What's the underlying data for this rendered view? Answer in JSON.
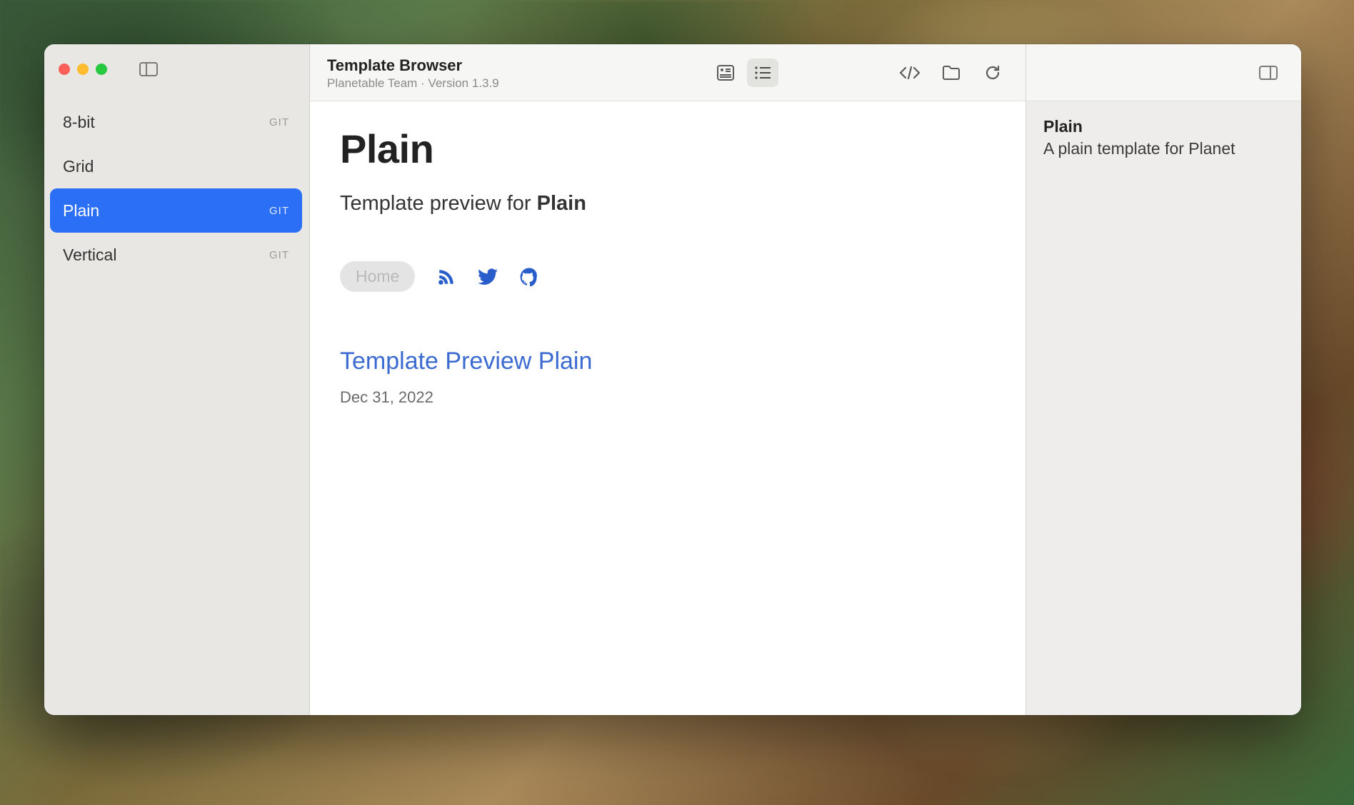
{
  "window": {
    "title": "Template Browser",
    "subtitle": "Planetable Team · Version 1.3.9"
  },
  "sidebar": {
    "items": [
      {
        "label": "8-bit",
        "badge": "GIT",
        "selected": false
      },
      {
        "label": "Grid",
        "badge": "",
        "selected": false
      },
      {
        "label": "Plain",
        "badge": "GIT",
        "selected": true
      },
      {
        "label": "Vertical",
        "badge": "GIT",
        "selected": false
      }
    ]
  },
  "preview": {
    "heading": "Plain",
    "subhead_prefix": "Template preview for ",
    "subhead_bold": "Plain",
    "home_label": "Home",
    "post_title": "Template Preview Plain",
    "post_date": "Dec 31, 2022"
  },
  "details": {
    "name": "Plain",
    "description": "A plain template for Planet"
  }
}
